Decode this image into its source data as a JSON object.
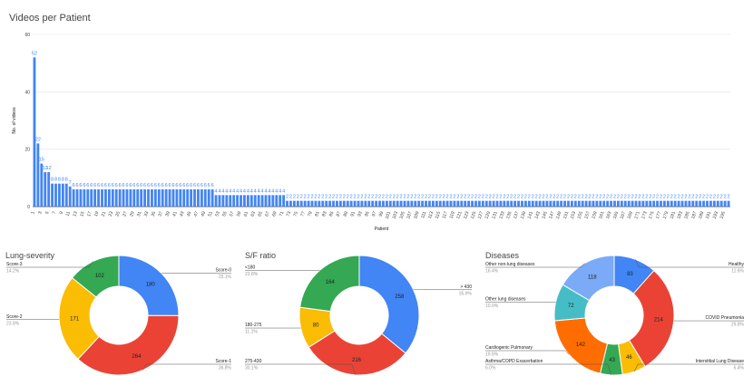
{
  "chart_data": [
    {
      "type": "bar",
      "title": "Videos per Patient",
      "xlabel": "Patient",
      "ylabel": "No. of videos",
      "ylim": [
        0,
        60
      ],
      "yticks": [
        0,
        20,
        40,
        60
      ],
      "grid": true,
      "color": "#4285f4",
      "segments": [
        {
          "count": 1,
          "value": 52
        },
        {
          "count": 1,
          "value": 22
        },
        {
          "count": 1,
          "value": 15
        },
        {
          "count": 2,
          "value": 12
        },
        {
          "count": 5,
          "value": 8
        },
        {
          "count": 1,
          "value": 7
        },
        {
          "count": 40,
          "value": 6
        },
        {
          "count": 20,
          "value": 4
        },
        {
          "count": 125,
          "value": 2
        }
      ],
      "xtick_labels": [
        "1",
        "3",
        "5",
        "7",
        "9",
        "11",
        "13",
        "15",
        "17",
        "19",
        "21",
        "23",
        "25",
        "27",
        "29",
        "31",
        "33",
        "35",
        "37",
        "39",
        "41",
        "43",
        "45",
        "47",
        "49",
        "51",
        "53",
        "55",
        "57",
        "59",
        "61",
        "63",
        "65",
        "67",
        "69",
        "71",
        "73",
        "75",
        "77",
        "79",
        "81",
        "83",
        "85",
        "87",
        "89",
        "91",
        "93",
        "95",
        "97",
        "99",
        "101",
        "103",
        "105",
        "107",
        "109",
        "111",
        "113",
        "115",
        "117",
        "119",
        "121",
        "123",
        "125",
        "127",
        "129",
        "131",
        "133",
        "135",
        "137",
        "139",
        "141",
        "143",
        "145",
        "147",
        "149",
        "151",
        "153",
        "155",
        "157",
        "159",
        "161",
        "163",
        "165",
        "167",
        "169",
        "171",
        "173",
        "175",
        "177",
        "179",
        "181",
        "183",
        "185",
        "187",
        "189",
        "191",
        "193",
        "195"
      ]
    },
    {
      "type": "pie",
      "title": "Lung-severity",
      "slices": [
        {
          "label": "Score-0",
          "value": 180,
          "pct": "25.1%",
          "color": "#4285f4"
        },
        {
          "label": "Score-1",
          "value": 264,
          "pct": "36.8%",
          "color": "#ea4335"
        },
        {
          "label": "Score-2",
          "value": 171,
          "pct": "23.8%",
          "color": "#fbbc04"
        },
        {
          "label": "Score-3",
          "value": 102,
          "pct": "14.2%",
          "color": "#34a853"
        }
      ]
    },
    {
      "type": "pie",
      "title": "S/F ratio",
      "slices": [
        {
          "label": "> 430",
          "value": 258,
          "pct": "35.9%",
          "color": "#4285f4"
        },
        {
          "label": "275-430",
          "value": 216,
          "pct": "30.1%",
          "color": "#ea4335"
        },
        {
          "label": "180-275",
          "value": 80,
          "pct": "11.1%",
          "color": "#fbbc04"
        },
        {
          "label": "<180",
          "value": 164,
          "pct": "22.8%",
          "color": "#34a853"
        }
      ]
    },
    {
      "type": "pie",
      "title": "Diseases",
      "slices": [
        {
          "label": "Healthy",
          "value": 83,
          "pct": "11.6%",
          "color": "#4285f4"
        },
        {
          "label": "COVID Pneumonia",
          "value": 214,
          "pct": "29.8%",
          "color": "#ea4335"
        },
        {
          "label": "Interstitial Lung Disease",
          "value": 46,
          "pct": "6.4%",
          "color": "#fbbc04"
        },
        {
          "label": "Asthma/COPD Exacerbation",
          "value": 43,
          "pct": "6.0%",
          "color": "#34a853"
        },
        {
          "label": "Cardiogenic Pulmonary",
          "value": 142,
          "pct": "19.8%",
          "color": "#ff6d01"
        },
        {
          "label": "Other lung diseases",
          "value": 72,
          "pct": "10.0%",
          "color": "#46bdc6"
        },
        {
          "label": "Other non-lung diseases",
          "value": 118,
          "pct": "16.4%",
          "color": "#7baaf7"
        }
      ]
    }
  ]
}
